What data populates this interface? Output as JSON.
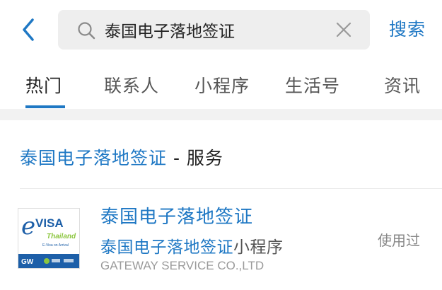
{
  "header": {
    "back_icon": "chevron-left-icon",
    "search": {
      "value": "泰国电子落地签证",
      "icon": "search-icon",
      "clear_icon": "close-icon"
    },
    "search_button": "搜索"
  },
  "tabs": [
    {
      "label": "热门",
      "active": true
    },
    {
      "label": "联系人",
      "active": false
    },
    {
      "label": "小程序",
      "active": false
    },
    {
      "label": "生活号",
      "active": false
    },
    {
      "label": "资讯",
      "active": false
    }
  ],
  "section": {
    "title_highlight": "泰国电子落地签证",
    "title_suffix": " - 服务"
  },
  "result": {
    "title": "泰国电子落地签证",
    "subtitle_highlight": "泰国电子落地签证",
    "subtitle_suffix": "小程序",
    "company": "GATEWAY SERVICE CO.,LTD",
    "status": "使用过",
    "logo": {
      "brand": "VISA",
      "brand_initial": "e",
      "country": "Thailand",
      "tagline": "E-Visa on Arrival",
      "footer_mark": "GW"
    }
  },
  "colors": {
    "accent": "#1f78c4",
    "text": "#222222",
    "muted": "#9a9a9a",
    "logo_blue": "#1d5fa8",
    "logo_green": "#8cc63f"
  }
}
